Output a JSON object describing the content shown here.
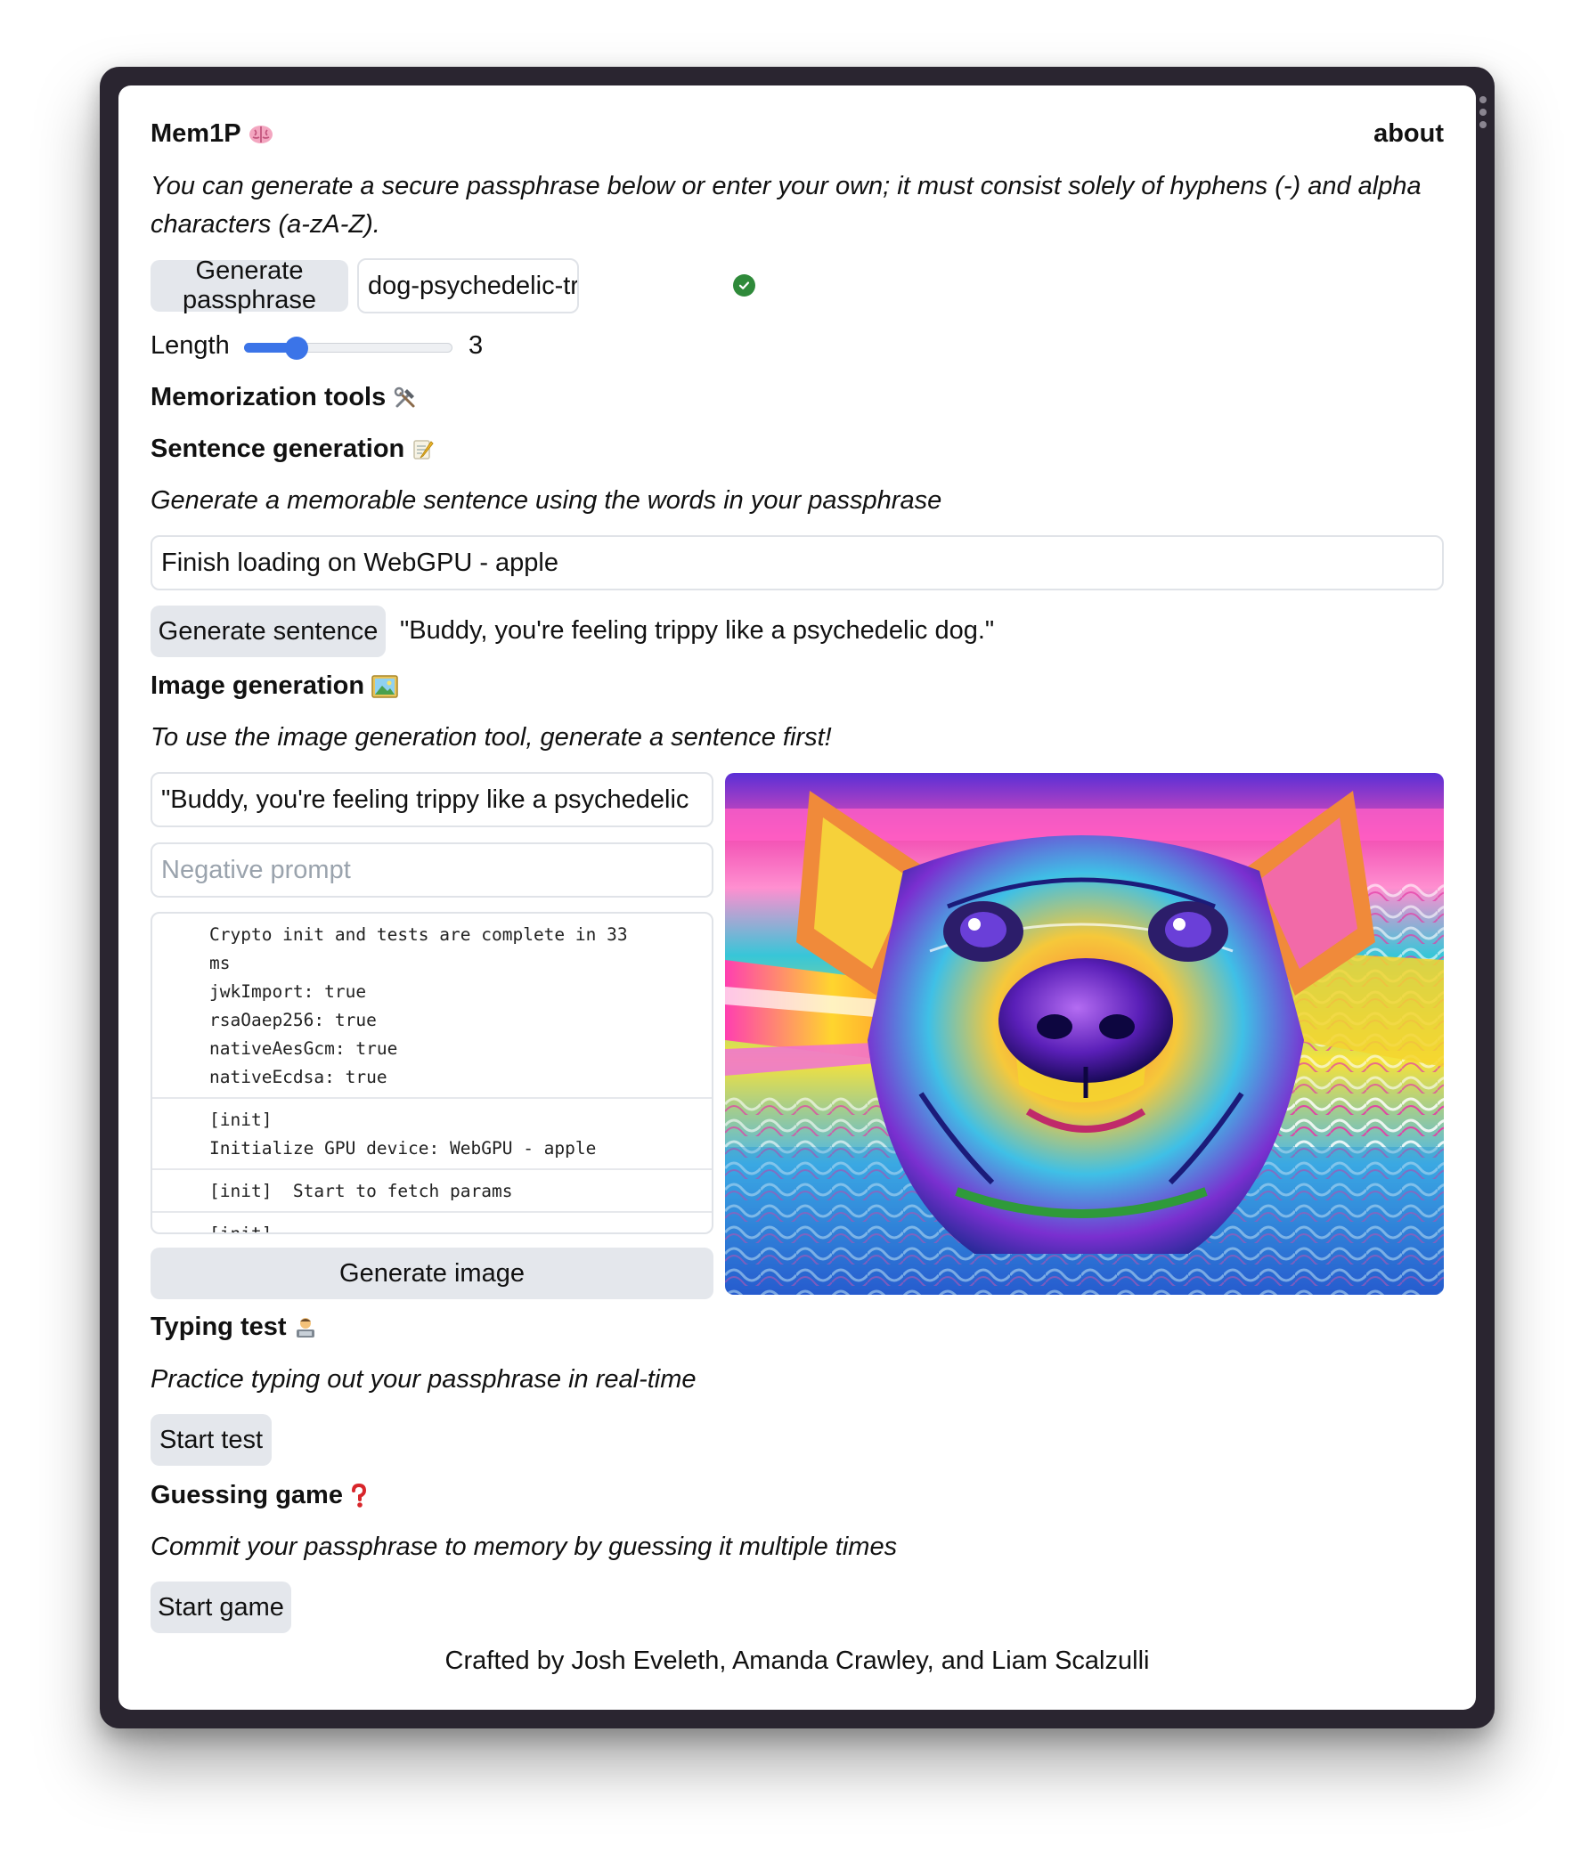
{
  "header": {
    "brand": "Mem1P",
    "brand_icon": "brain-icon",
    "about_link": "about"
  },
  "intro": "You can generate a secure passphrase below or enter your own; it must consist solely of hyphens (-) and alpha characters (a-zA-Z).",
  "passphrase": {
    "generate_button": "Generate passphrase",
    "value": "dog-psychedelic-trippy",
    "valid_icon": "check-circle-icon",
    "valid_color": "#2f8a3a",
    "length_label": "Length",
    "length_value": "3",
    "length_slider_fraction": 0.25,
    "slider_color": "#3b74e8"
  },
  "memorization": {
    "title": "Memorization tools",
    "title_icon": "hammer-and-wrench-icon"
  },
  "sentence": {
    "title": "Sentence generation",
    "title_icon": "memo-icon",
    "description": "Generate a memorable sentence using the words in your passphrase",
    "model_status": "Finish loading on WebGPU - apple",
    "generate_button": "Generate sentence",
    "result": "\"Buddy, you're feeling trippy like a psychedelic dog.\""
  },
  "image": {
    "title": "Image generation",
    "title_icon": "framed-picture-icon",
    "description": "To use the image generation tool, generate a sentence first!",
    "prompt_value": "\"Buddy, you're feeling trippy like a psychedelic",
    "negative_placeholder": "Negative prompt",
    "log": [
      "Crypto init and tests are complete in 33\nms\njwkImport: true\nrsaOaep256: true\nnativeAesGcm: true\nnativeEcdsa: true",
      "[init]\nInitialize GPU device: WebGPU - apple",
      "[init]  Start to fetch params",
      "[init]"
    ],
    "generate_button": "Generate image"
  },
  "typing": {
    "title": "Typing test",
    "title_icon": "technologist-icon",
    "description": "Practice typing out your passphrase in real-time",
    "button": "Start test"
  },
  "guessing": {
    "title": "Guessing game",
    "title_icon": "question-mark-icon",
    "description": "Commit your passphrase to memory by guessing it multiple times",
    "button": "Start game"
  },
  "footer": "Crafted by Josh Eveleth, Amanda Crawley, and Liam Scalzulli"
}
